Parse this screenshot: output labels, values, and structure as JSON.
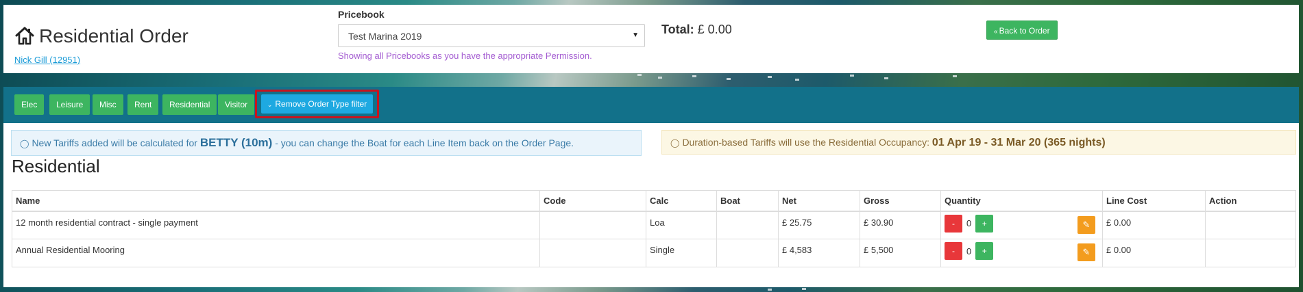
{
  "header": {
    "title": "Residential Order",
    "customer_link": "Nick Gill (12951)",
    "pricebook_label": "Pricebook",
    "pricebook_selected": "Test Marina 2019",
    "permission_note": "Showing all Pricebooks as you have the appropriate Permission.",
    "total_label": "Total:",
    "total_value": "£ 0.00",
    "back_button_label": "Back to Order"
  },
  "filters": {
    "buttons": [
      "Elec",
      "Leisure",
      "Misc",
      "Rent",
      "Residential",
      "Visitor"
    ],
    "remove_filter_label": "Remove Order Type filter"
  },
  "alerts": {
    "info_prefix": "New Tariffs added will be calculated for",
    "info_boat": "BETTY (10m)",
    "info_suffix": "- you can change the Boat for each Line Item back on the Order Page.",
    "warn_prefix": "Duration-based Tariffs will use the Residential Occupancy:",
    "warn_occupancy": "01 Apr 19 - 31 Mar 20 (365 nights)"
  },
  "section_title": "Residential",
  "table": {
    "columns": [
      "Name",
      "Code",
      "Calc",
      "Boat",
      "Net",
      "Gross",
      "Quantity",
      "Line Cost",
      "Action"
    ],
    "rows": [
      {
        "name": "12 month residential contract - single payment",
        "code": "",
        "calc": "Loa",
        "boat": "",
        "net": "£ 25.75",
        "gross": "£ 30.90",
        "quantity": "0",
        "line_cost": "£ 0.00"
      },
      {
        "name": "Annual Residential Mooring",
        "code": "",
        "calc": "Single",
        "boat": "",
        "net": "£ 4,583",
        "gross": "£ 5,500",
        "quantity": "0",
        "line_cost": "£ 0.00"
      }
    ],
    "minus_label": "-",
    "plus_label": "+"
  },
  "colors": {
    "filter_bar": "#12718a",
    "green_button": "#3db560",
    "blue_button": "#1ea9e1",
    "highlight_border": "#c8141e",
    "minus_button": "#e8373a",
    "edit_button": "#f39c1e"
  },
  "icons": {
    "title_icon": "home-icon",
    "back_icon": "double-chevron-left-icon",
    "remove_filter_icon": "chevron-down-icon",
    "alert_icon": "lightbulb-icon",
    "edit_icon": "edit-icon"
  }
}
